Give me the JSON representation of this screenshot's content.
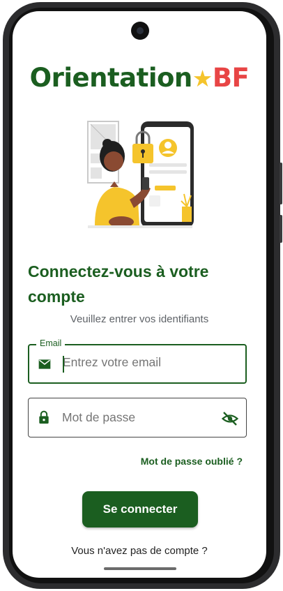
{
  "logo": {
    "part1": "Orientation",
    "star": "★",
    "part2": "BF"
  },
  "login": {
    "title": "Connectez-vous à votre compte",
    "subtitle": "Veuillez entrer vos identifiants",
    "email": {
      "label": "Email",
      "placeholder": "Entrez votre email",
      "icon": "mail-icon"
    },
    "password": {
      "placeholder": "Mot de passe",
      "icon": "lock-icon",
      "toggle_icon": "eye-off-icon"
    },
    "forgot_link": "Mot de passe oublié ?",
    "submit_label": "Se connecter",
    "signup_prompt": "Vous n'avez pas de compte ?"
  },
  "colors": {
    "primary": "#1b5e20",
    "star": "#f5c42c",
    "accent_red": "#e84545"
  }
}
